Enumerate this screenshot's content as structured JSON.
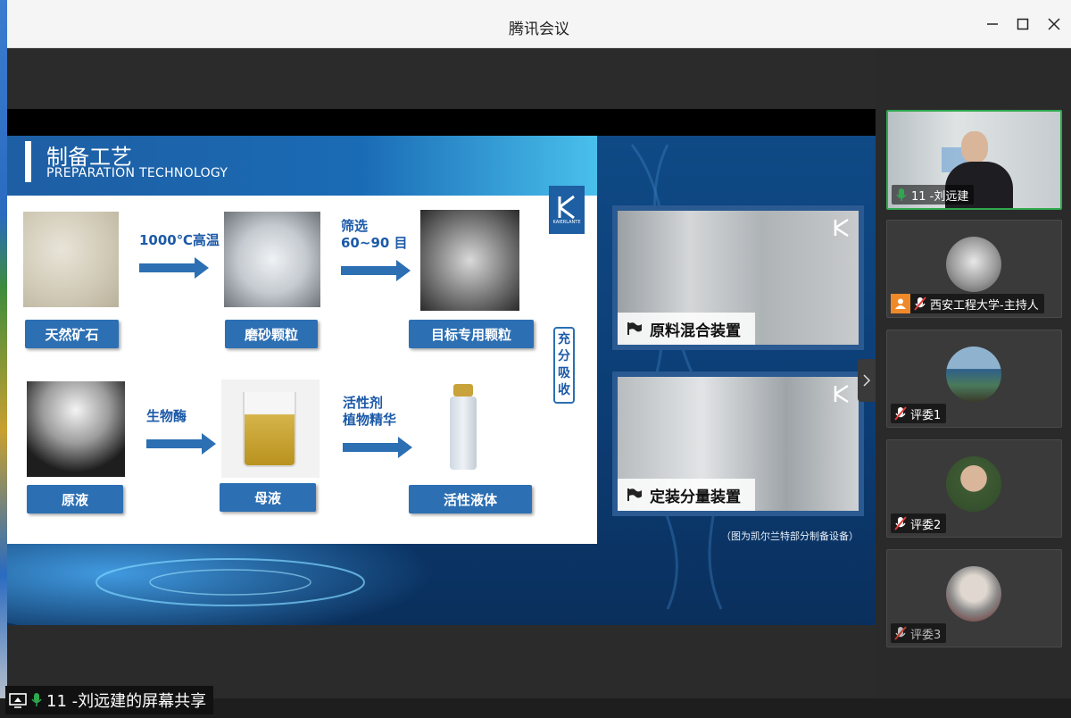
{
  "window": {
    "title": "腾讯会议"
  },
  "slide": {
    "heading_cn": "制备工艺",
    "heading_en": "PREPARATION TECHNOLOGY",
    "logo_text": "KAIERLANTE",
    "row1": {
      "item1": "天然矿石",
      "arrow1": "1000℃高温",
      "item2": "磨砂颗粒",
      "arrow2_line1": "筛选",
      "arrow2_line2": "60~90 目",
      "item3": "目标专用颗粒"
    },
    "row2": {
      "item1": "原液",
      "arrow1": "生物酶",
      "item2": "母液",
      "arrow2_line1": "活性剂",
      "arrow2_line2": "植物精华",
      "item3": "活性液体"
    },
    "side_note": [
      "充",
      "分",
      "吸",
      "收"
    ],
    "equipment": [
      {
        "caption": "原料混合装置"
      },
      {
        "caption": "定装分量装置"
      }
    ],
    "footnote": "（图为凯尔兰特部分制备设备）"
  },
  "participants": [
    {
      "name": "11 -刘远建",
      "mic": "on",
      "active": true
    },
    {
      "name": "西安工程大学-主持人",
      "mic": "muted",
      "host": true
    },
    {
      "name": "评委1",
      "mic": "muted"
    },
    {
      "name": "评委2",
      "mic": "muted"
    },
    {
      "name": "评委3",
      "mic": "muted"
    }
  ],
  "screen_share": {
    "label": "11 -刘远建的屏幕共享"
  },
  "colors": {
    "accent_green": "#2fa84f",
    "slide_blue": "#2c6fb3"
  }
}
